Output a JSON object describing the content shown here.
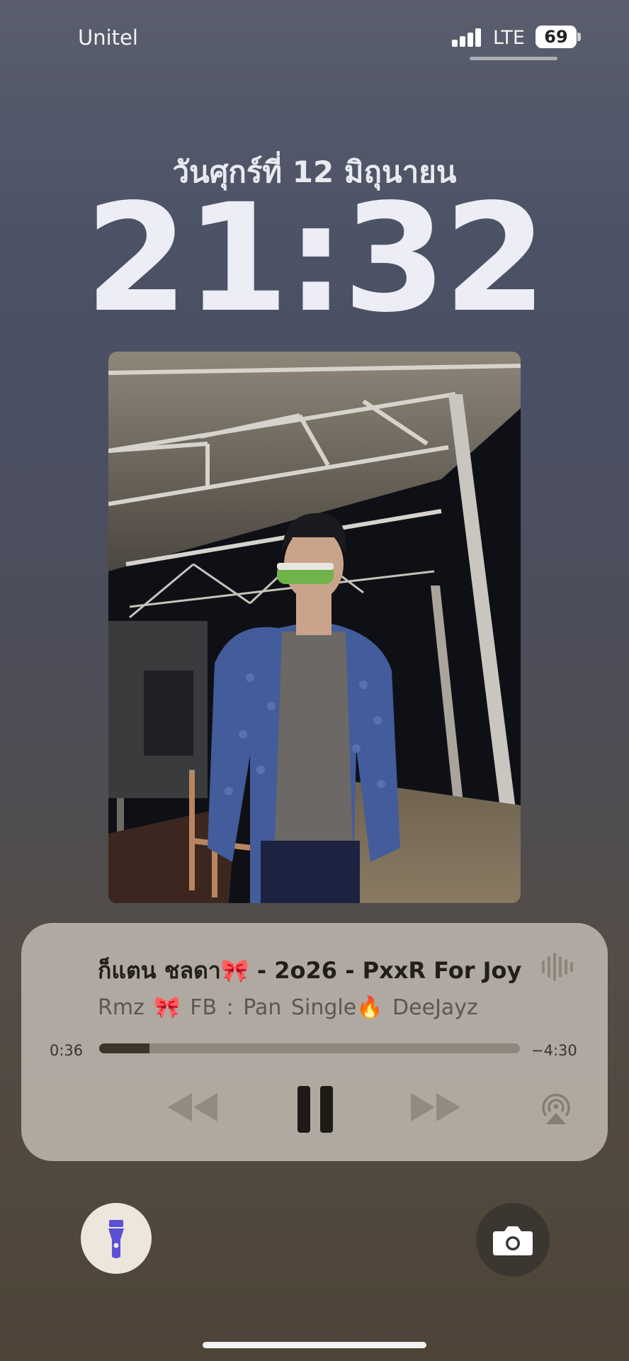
{
  "status_bar": {
    "carrier": "Unitel",
    "network": "LTE",
    "battery": "69"
  },
  "lock_screen": {
    "date": "วันศุกร์ที่ 12 มิถุนายน",
    "time": "21:32"
  },
  "now_playing": {
    "title": "ก็แตน ชลดา🎀 - 2o26 - PxxR For Joy",
    "subtitle": "Rmz 🎀   FB : Pan Single🔥 DeeJayz",
    "elapsed": "0:36",
    "remaining": "−4:30",
    "progress": 0.12
  },
  "icons": {
    "rewind": "rewind-icon",
    "pause": "pause-icon",
    "forward": "fast-forward-icon",
    "airplay": "airplay-icon",
    "flashlight": "flashlight-icon",
    "camera": "camera-icon"
  },
  "colors": {
    "flashlight_accent": "#5b4fd6"
  }
}
